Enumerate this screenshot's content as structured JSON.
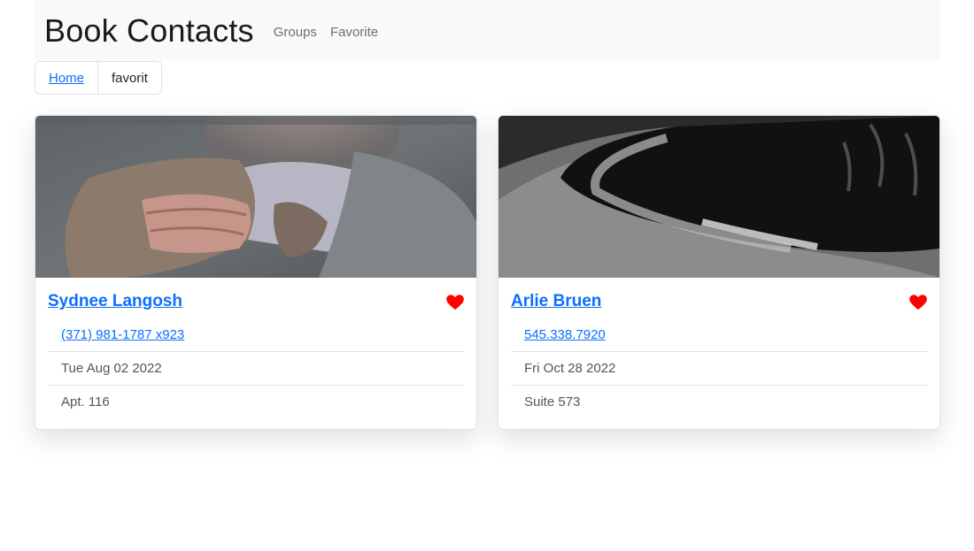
{
  "app": {
    "brand": "Book Contacts"
  },
  "nav": {
    "items": [
      {
        "label": "Groups"
      },
      {
        "label": "Favorite"
      }
    ]
  },
  "breadcrumb": {
    "home": "Home",
    "current": "favorit"
  },
  "contacts": [
    {
      "name": "Sydnee Langosh",
      "phone": "(371) 981-1787 x923",
      "date": "Tue Aug 02 2022",
      "address": "Apt. 116",
      "favorite": true
    },
    {
      "name": "Arlie Bruen",
      "phone": "545.338.7920",
      "date": "Fri Oct 28 2022",
      "address": "Suite 573",
      "favorite": true
    }
  ],
  "colors": {
    "link": "#0d6efd",
    "heart": "#ff0000",
    "navbar_bg": "#f8f9fa"
  }
}
